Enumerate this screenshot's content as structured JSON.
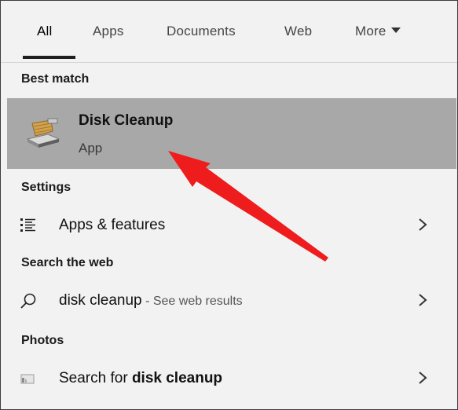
{
  "tabs": [
    {
      "label": "All",
      "active": true
    },
    {
      "label": "Apps"
    },
    {
      "label": "Documents"
    },
    {
      "label": "Web"
    },
    {
      "label": "More"
    }
  ],
  "sections": {
    "best_match": "Best match",
    "settings": "Settings",
    "search_web": "Search the web",
    "photos": "Photos"
  },
  "best_match": {
    "title": "Disk Cleanup",
    "subtitle": "App",
    "icon": "disk-cleanup-icon"
  },
  "settings_item": {
    "label": "Apps & features",
    "icon": "list-icon"
  },
  "web_item": {
    "query": "disk cleanup",
    "suffix": " - See web results",
    "icon": "search-icon"
  },
  "photos_item": {
    "prefix": "Search for ",
    "query": "disk cleanup",
    "icon": "photo-icon"
  },
  "colors": {
    "highlight": "#a8a8a8",
    "panel": "#f2f2f2",
    "arrow": "#ee1c1c"
  }
}
